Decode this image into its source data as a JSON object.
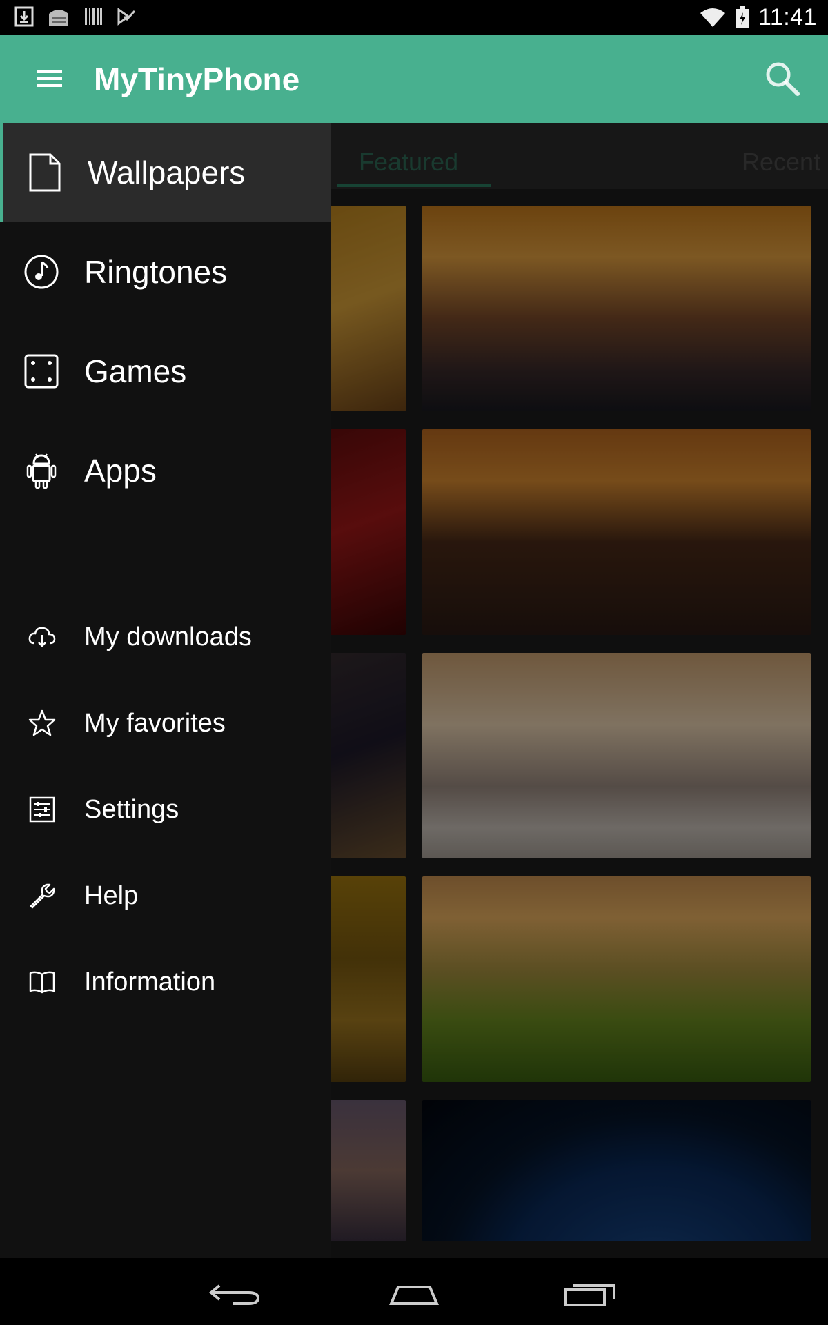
{
  "status_bar": {
    "time": "11:41",
    "icons_left": [
      "download-icon",
      "store-icon",
      "barcode-icon",
      "check-icon"
    ],
    "icons_right": [
      "wifi-icon",
      "battery-icon"
    ]
  },
  "app_bar": {
    "title": "MyTinyPhone",
    "background": "#48b08f"
  },
  "tabs": [
    {
      "label": "Featured",
      "selected": true
    },
    {
      "label": "Recent",
      "selected": false
    }
  ],
  "drawer": {
    "main_items": [
      {
        "label": "Wallpapers",
        "icon": "file-icon",
        "selected": true
      },
      {
        "label": "Ringtones",
        "icon": "music-note-icon",
        "selected": false
      },
      {
        "label": "Games",
        "icon": "dice-icon",
        "selected": false
      },
      {
        "label": "Apps",
        "icon": "android-icon",
        "selected": false
      }
    ],
    "secondary_items": [
      {
        "label": "My downloads",
        "icon": "cloud-download-icon"
      },
      {
        "label": "My favorites",
        "icon": "star-icon"
      },
      {
        "label": "Settings",
        "icon": "settings-sliders-icon"
      },
      {
        "label": "Help",
        "icon": "wrench-icon"
      },
      {
        "label": "Information",
        "icon": "book-icon"
      }
    ]
  },
  "wallpapers": [
    "city-canal-sunset",
    "new-york-skyline-dusk",
    "floating-rock-waterfall",
    "forest-sunrise",
    "earth-from-space"
  ],
  "nav_bar": [
    "back-icon",
    "home-icon",
    "recents-icon"
  ]
}
